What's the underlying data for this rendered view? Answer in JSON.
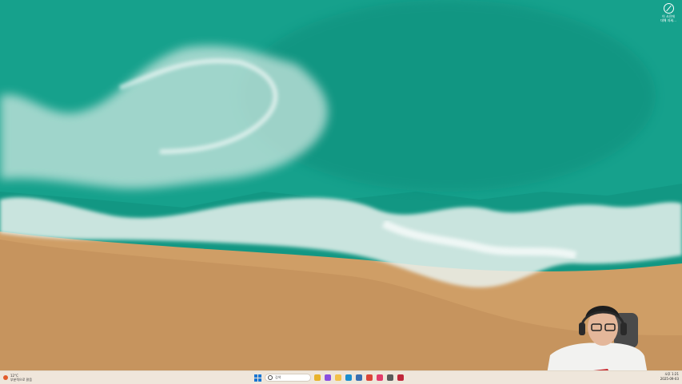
{
  "corner_widget": {
    "icon": "slash-circle-icon",
    "line1": "이 사진에",
    "line2": "대해 자세..."
  },
  "taskbar": {
    "weather": {
      "temp": "12°C",
      "desc": "부분적으로 맑음"
    },
    "search_placeholder": "검색",
    "apps": [
      {
        "name": "file-explorer-icon",
        "color": "#e8b22b"
      },
      {
        "name": "copilot-icon",
        "color": "#8a4ee0"
      },
      {
        "name": "folder-icon",
        "color": "#f2c04a"
      },
      {
        "name": "edge-icon",
        "color": "#1a8fcf"
      },
      {
        "name": "store-icon",
        "color": "#3a6fb0"
      },
      {
        "name": "chrome-icon",
        "color": "#db4437"
      },
      {
        "name": "media-icon",
        "color": "#e23b6a"
      },
      {
        "name": "diamond-app-icon",
        "color": "#5a5a5a"
      },
      {
        "name": "app-icon",
        "color": "#c0273a"
      }
    ],
    "clock": {
      "time": "오후 1:21",
      "date": "2025-09-03"
    }
  }
}
